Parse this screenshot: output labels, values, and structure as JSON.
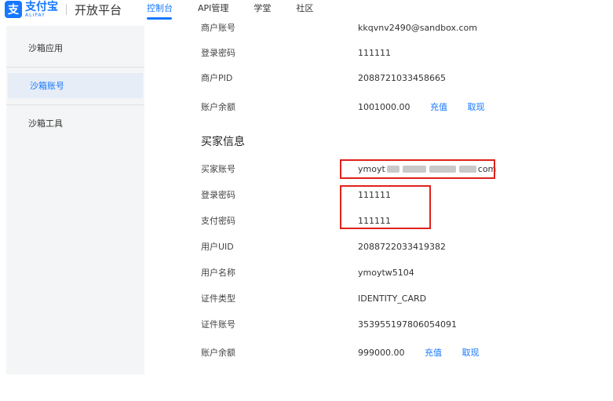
{
  "header": {
    "logo_cn": "支付宝",
    "logo_en": "ALIPAY",
    "platform": "开放平台",
    "nav": [
      {
        "label": "控制台",
        "active": true
      },
      {
        "label": "API管理"
      },
      {
        "label": "学堂"
      },
      {
        "label": "社区"
      }
    ]
  },
  "sidebar": {
    "items": [
      {
        "label": "沙箱应用"
      },
      {
        "label": "沙箱账号",
        "active": true
      },
      {
        "label": "沙箱工具"
      }
    ]
  },
  "merchant": {
    "account_label": "商户账号",
    "account_value": "kkqvnv2490@sandbox.com",
    "password_label": "登录密码",
    "password_value": "111111",
    "pid_label": "商户PID",
    "pid_value": "2088721033458665",
    "balance_label": "账户余额",
    "balance_value": "1001000.00",
    "recharge": "充值",
    "withdraw": "取现"
  },
  "buyer": {
    "title": "买家信息",
    "account_label": "买家账号",
    "account_prefix": "ymoyt",
    "account_suffix": "com",
    "login_password_label": "登录密码",
    "login_password_value": "111111",
    "pay_password_label": "支付密码",
    "pay_password_value": "111111",
    "uid_label": "用户UID",
    "uid_value": "2088722033419382",
    "name_label": "用户名称",
    "name_value": "ymoytw5104",
    "id_type_label": "证件类型",
    "id_type_value": "IDENTITY_CARD",
    "id_number_label": "证件账号",
    "id_number_value": "353955197806054091",
    "balance_label": "账户余额",
    "balance_value": "999000.00",
    "recharge": "充值",
    "withdraw": "取现"
  },
  "colors": {
    "accent": "#1677ff",
    "highlight": "#e0211b"
  }
}
